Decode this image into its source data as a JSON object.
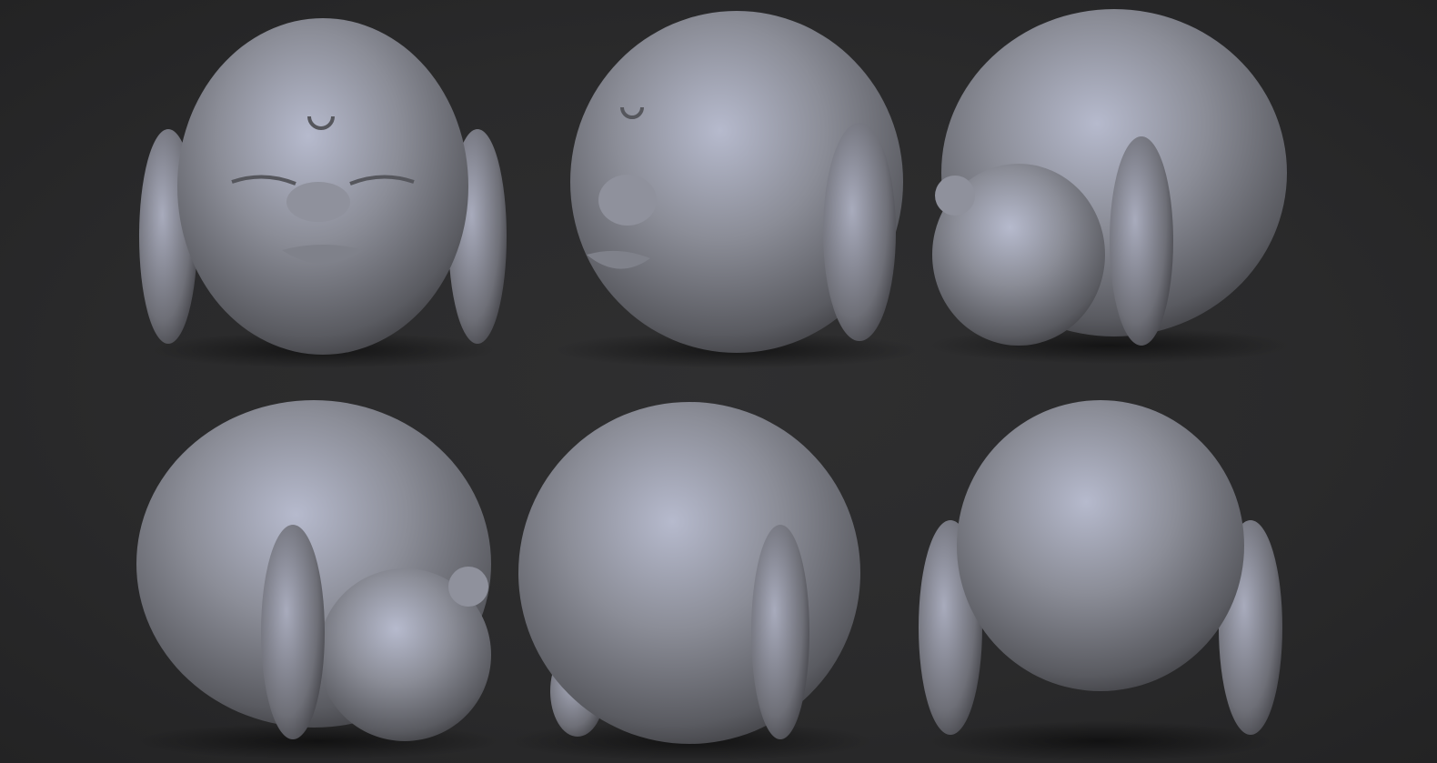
{
  "colors": {
    "background": "#2b2b2c",
    "clay_light": "#b4b8cc",
    "clay_mid": "#7d7f88",
    "clay_dark": "#3a3a3e"
  }
}
